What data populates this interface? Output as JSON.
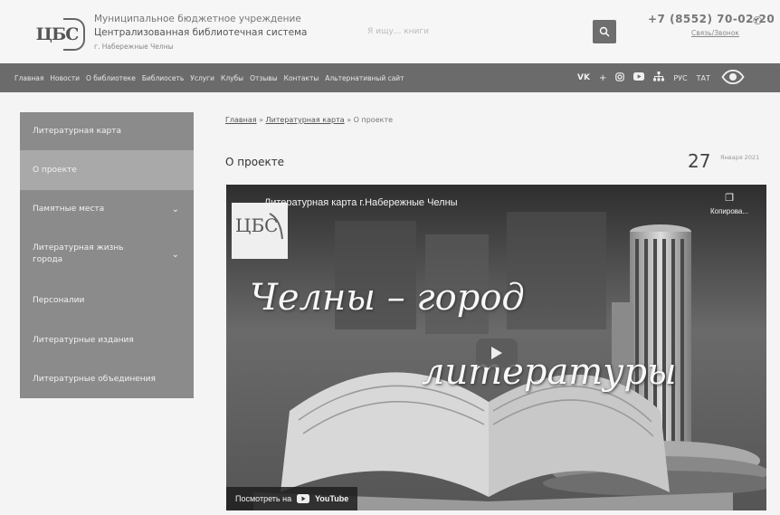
{
  "header": {
    "logo_text": "ЦБС",
    "org_line1": "Муниципальное бюджетное учреждение",
    "org_line2": "Централизованная библиотечная система",
    "org_line3": "г. Набережные Челны",
    "search_placeholder": "Я ищу... книги",
    "phone": "+7 (8552) 70-02-20",
    "callback": "Связь/Звонок"
  },
  "nav": {
    "items": [
      "Главная",
      "Новости",
      "О библиотеке",
      "Библиосеть",
      "Услуги",
      "Клубы",
      "Отзывы",
      "Контакты",
      "Альтернативный сайт"
    ],
    "social_icons": [
      "vk-icon",
      "plus-icon",
      "instagram-icon",
      "youtube-icon",
      "sitemap-icon"
    ],
    "lang_ru": "РУС",
    "lang_tat": "ТАТ"
  },
  "sidebar": {
    "items": [
      {
        "label": "Литературная карта",
        "expandable": false
      },
      {
        "label": "О проекте",
        "expandable": false,
        "active": true
      },
      {
        "label": "Памятные места",
        "expandable": true
      },
      {
        "label": "Литературная жизнь города",
        "expandable": true
      },
      {
        "label": "Персоналии",
        "expandable": false
      },
      {
        "label": "Литературные издания",
        "expandable": false
      },
      {
        "label": "Литературные объединения",
        "expandable": false
      }
    ]
  },
  "breadcrumb": {
    "home": "Главная",
    "sep": " » ",
    "map": "Литературная карта",
    "current": "О проекте"
  },
  "page": {
    "title": "О проекте",
    "date_day": "27",
    "date_month": "Января 2021"
  },
  "video": {
    "title": "Литературная карта г.Набережные Челны",
    "copy_label": "Копирова...",
    "overlay_line1": "Челны – город",
    "overlay_line2": "литературы",
    "watch_on": "Посмотреть на",
    "youtube": "YouTube"
  },
  "colors": {
    "nav_bg": "#6b6b6b",
    "sidebar_bg": "#8b8b8b",
    "sidebar_active": "#a9a9a9"
  }
}
